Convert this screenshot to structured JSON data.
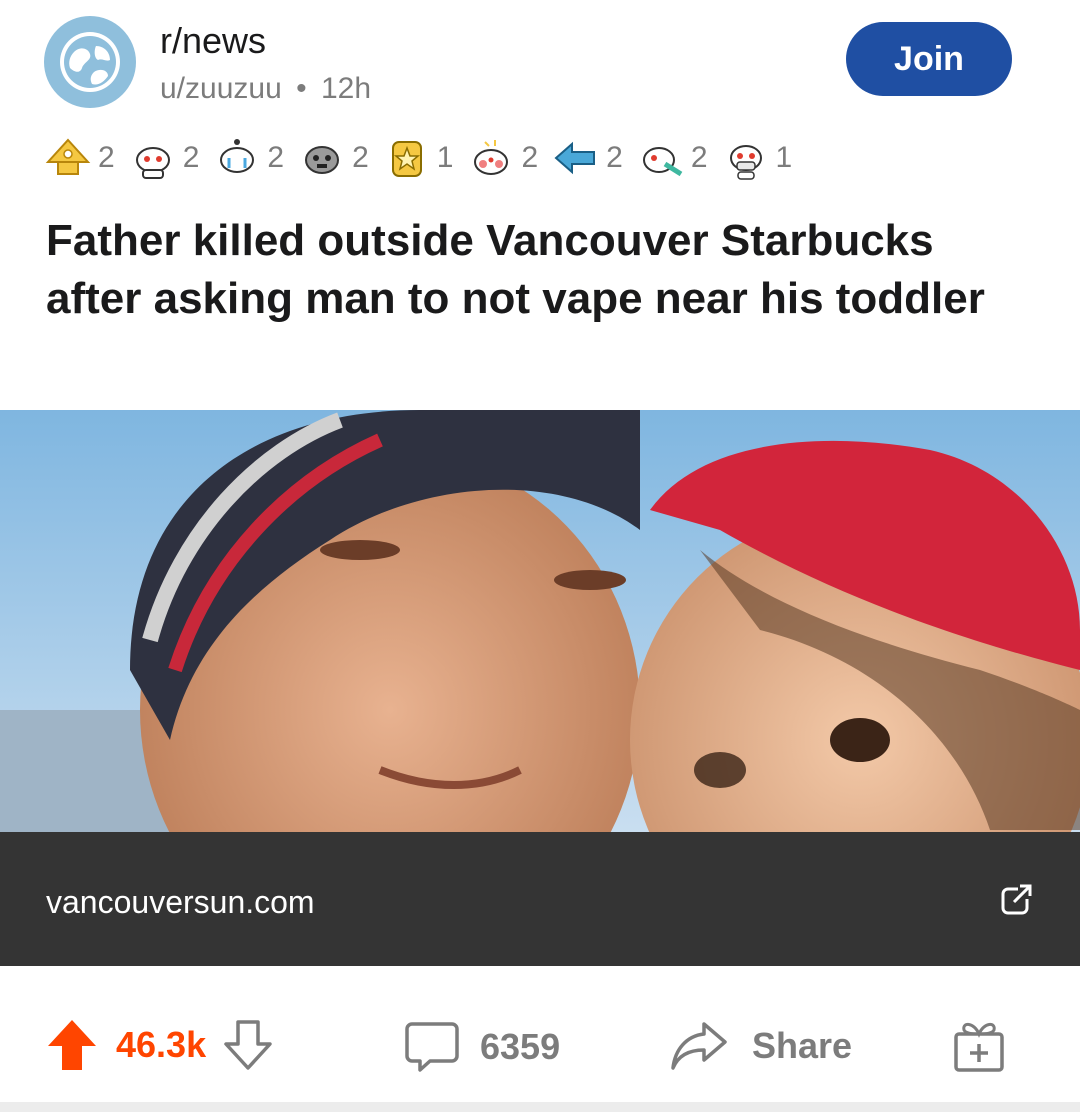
{
  "post": {
    "subreddit": "r/news",
    "author": "u/zuuzuu",
    "separator": "•",
    "age": "12h",
    "join_label": "Join",
    "title": "Father killed outside Vancouver Starbucks after asking man to not vape near his toddler",
    "domain": "vancouversun.com"
  },
  "awards": [
    {
      "icon": "pyramid-award-icon",
      "count": "2"
    },
    {
      "icon": "snoo-award-icon",
      "count": "2"
    },
    {
      "icon": "crying-snoo-award-icon",
      "count": "2"
    },
    {
      "icon": "gray-snoo-award-icon",
      "count": "2"
    },
    {
      "icon": "star-medal-award-icon",
      "count": "1"
    },
    {
      "icon": "blushing-snoo-award-icon",
      "count": "2"
    },
    {
      "icon": "arrow-award-icon",
      "count": "2"
    },
    {
      "icon": "vomit-snoo-award-icon",
      "count": "2"
    },
    {
      "icon": "masked-snoo-award-icon",
      "count": "1"
    }
  ],
  "actions": {
    "upvotes": "46.3k",
    "comments": "6359",
    "share_label": "Share"
  },
  "colors": {
    "join_bg": "#1f4fa3",
    "upvote_active": "#ff4500",
    "link_bar_bg": "#343434",
    "meta_text": "#7c7c7c"
  }
}
